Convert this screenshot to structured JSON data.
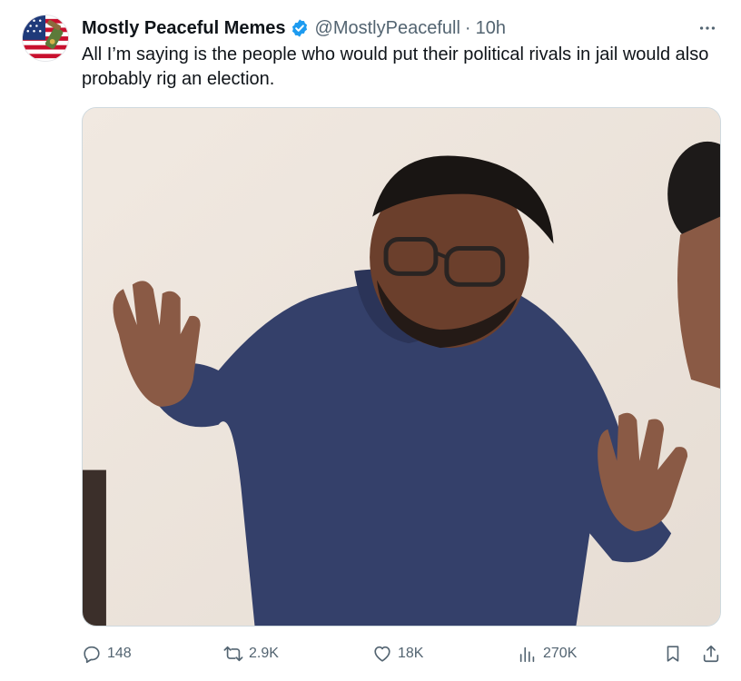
{
  "tweet": {
    "display_name": "Mostly Peaceful Memes",
    "verified": true,
    "handle": "@MostlyPeacefull",
    "separator": "·",
    "time": "10h",
    "text": "All I’m saying is the people who would put their political rivals in jail would also probably rig an election.",
    "avatar_icon": "flag-avatar-icon",
    "media_description_icon": "meme-image"
  },
  "actions": {
    "reply": {
      "icon": "reply-icon",
      "count": "148"
    },
    "retweet": {
      "icon": "retweet-icon",
      "count": "2.9K"
    },
    "like": {
      "icon": "heart-icon",
      "count": "18K"
    },
    "views": {
      "icon": "views-chart-icon",
      "count": "270K"
    },
    "bookmark": {
      "icon": "bookmark-icon"
    },
    "share": {
      "icon": "share-icon"
    }
  },
  "colors": {
    "text_primary": "#0f1419",
    "text_secondary": "#536471",
    "verified_blue": "#1d9bf0",
    "border": "#cfd9de"
  }
}
